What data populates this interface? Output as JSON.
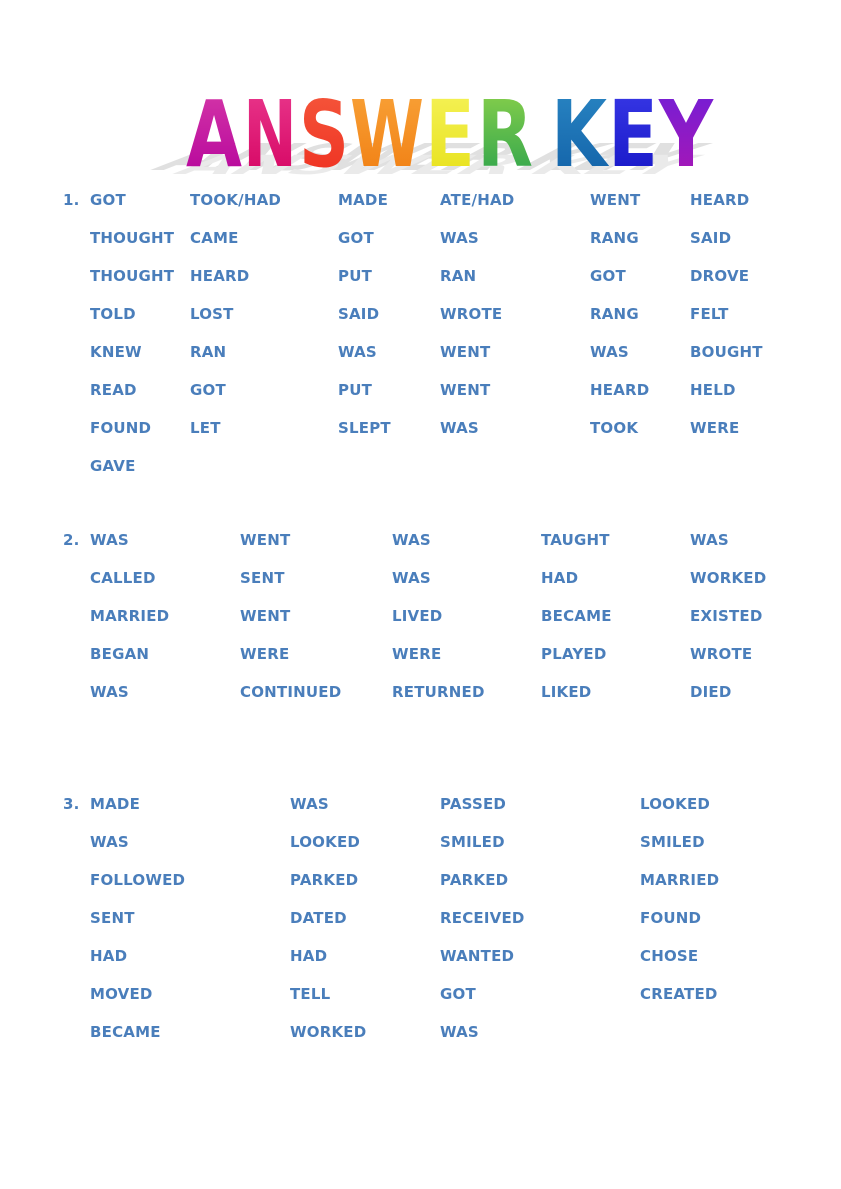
{
  "document": {
    "title": "ANSWER KEY",
    "text_color": "#4a7ebb",
    "background_color": "#ffffff"
  },
  "heading": {
    "text": "ANSWER KEY",
    "letters": [
      {
        "char": "A",
        "color_top": "#d63aa8",
        "color_bottom": "#b3009b"
      },
      {
        "char": "N",
        "color_top": "#e6267f",
        "color_bottom": "#d4005f"
      },
      {
        "char": "S",
        "color_top": "#f5472e",
        "color_bottom": "#ee3124"
      },
      {
        "char": "W",
        "color_top": "#f79226",
        "color_bottom": "#f07c14"
      },
      {
        "char": "E",
        "color_top": "#f2ef3a",
        "color_bottom": "#e8e21c"
      },
      {
        "char": "R",
        "color_top": "#7ac943",
        "color_bottom": "#2aa14a"
      },
      {
        "char": "K",
        "color_top": "#1b76b8",
        "color_bottom": "#1565a8"
      },
      {
        "char": "E",
        "color_top": "#2b2bdd",
        "color_bottom": "#1a1ac8"
      },
      {
        "char": "Y",
        "color_top": "#7b1fd4",
        "color_bottom": "#a71bb5"
      }
    ],
    "shadow_color": "#d2d2d2"
  },
  "answers": [
    {
      "number": "1.",
      "columns_x": [
        90,
        190,
        338,
        440,
        590,
        690
      ],
      "rows": [
        [
          "GOT",
          "TOOK/HAD",
          "MADE",
          "ATE/HAD",
          "WENT",
          "HEARD"
        ],
        [
          "THOUGHT",
          "CAME",
          "GOT",
          "WAS",
          "RANG",
          "SAID"
        ],
        [
          "THOUGHT",
          "HEARD",
          "PUT",
          "RAN",
          "GOT",
          "DROVE"
        ],
        [
          "TOLD",
          "LOST",
          "SAID",
          "WROTE",
          "RANG",
          "FELT"
        ],
        [
          "KNEW",
          "RAN",
          "WAS",
          "WENT",
          "WAS",
          "BOUGHT"
        ],
        [
          "READ",
          "GOT",
          "PUT",
          "WENT",
          "HEARD",
          "HELD"
        ],
        [
          "FOUND",
          "LET",
          "SLEPT",
          "WAS",
          "TOOK",
          "WERE"
        ],
        [
          "GAVE",
          "",
          "",
          "",
          "",
          ""
        ]
      ]
    },
    {
      "number": "2.",
      "columns_x": [
        90,
        240,
        392,
        541,
        690
      ],
      "rows": [
        [
          "WAS",
          "WENT",
          "WAS",
          "TAUGHT",
          "WAS"
        ],
        [
          "CALLED",
          "SENT",
          "WAS",
          "HAD",
          "WORKED"
        ],
        [
          "MARRIED",
          "WENT",
          "LIVED",
          "BECAME",
          "EXISTED"
        ],
        [
          "BEGAN",
          "WERE",
          "WERE",
          "PLAYED",
          "WROTE"
        ],
        [
          "WAS",
          "CONTINUED",
          "RETURNED",
          "LIKED",
          "DIED"
        ]
      ]
    },
    {
      "number": "3.",
      "columns_x": [
        90,
        290,
        440,
        640
      ],
      "rows": [
        [
          "MADE",
          "WAS",
          "PASSED",
          "LOOKED"
        ],
        [
          "WAS",
          "LOOKED",
          "SMILED",
          "SMILED"
        ],
        [
          "FOLLOWED",
          "PARKED",
          "PARKED",
          "MARRIED"
        ],
        [
          "SENT",
          "DATED",
          "RECEIVED",
          "FOUND"
        ],
        [
          "HAD",
          "HAD",
          "WANTED",
          "CHOSE"
        ],
        [
          "MOVED",
          "TELL",
          "GOT",
          "CREATED"
        ],
        [
          "BECAME",
          "WORKED",
          "WAS",
          ""
        ]
      ]
    }
  ]
}
